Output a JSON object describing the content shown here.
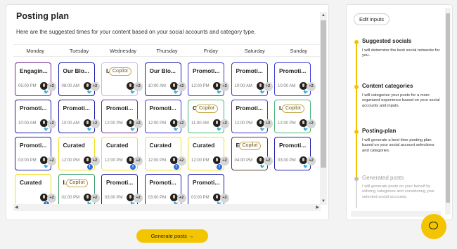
{
  "header": {
    "title": "Posting plan",
    "subtitle": "Here are the suggested times for your content based on your social accounts and category type."
  },
  "days": [
    "Monday",
    "Tuesday",
    "Wednesday",
    "Thursday",
    "Friday",
    "Saturday",
    "Sunday"
  ],
  "posts": [
    {
      "day": 0,
      "slot": 0,
      "title": "Engagin...",
      "time": "05:00 PM",
      "border": "#7a2a8f",
      "net": "tw"
    },
    {
      "day": 1,
      "slot": 0,
      "title": "Our Blo...",
      "time": "08:00 AM",
      "border": "#1d1da8",
      "net": "tw"
    },
    {
      "day": 2,
      "slot": 0,
      "title": "I...",
      "time": "",
      "border": "#c9b7e8",
      "net": "tw",
      "copilot": "Copilot"
    },
    {
      "day": 3,
      "slot": 0,
      "title": "Our Blo...",
      "time": "10:00 AM",
      "border": "#1d1da8",
      "net": "tw"
    },
    {
      "day": 4,
      "slot": 0,
      "title": "Promoti...",
      "time": "12:00 PM",
      "border": "#3a3ad8",
      "net": "tw"
    },
    {
      "day": 5,
      "slot": 0,
      "title": "Promoti...",
      "time": "10:00 AM",
      "border": "#3a3ad8",
      "net": "tw"
    },
    {
      "day": 6,
      "slot": 0,
      "title": "Promoti...",
      "time": "10:00 AM",
      "border": "#3a3ad8",
      "net": "tw"
    },
    {
      "day": 0,
      "slot": 1,
      "title": "Promoti...",
      "time": "10:00 AM",
      "border": "#1d1da8",
      "net": "tw"
    },
    {
      "day": 1,
      "slot": 1,
      "title": "Promoti...",
      "time": "10:00 AM",
      "border": "#1d1da8",
      "net": "tw"
    },
    {
      "day": 2,
      "slot": 1,
      "title": "Promoti...",
      "time": "12:00 PM",
      "border": "#7a2a8f",
      "net": "tw"
    },
    {
      "day": 3,
      "slot": 1,
      "title": "Promoti...",
      "time": "12:00 PM",
      "border": "#3a3ad8",
      "net": "tw"
    },
    {
      "day": 4,
      "slot": 1,
      "title": "C",
      "time": "11:00 AM",
      "border": "#4ab57a",
      "net": "tw",
      "copilot": "Copilot"
    },
    {
      "day": 5,
      "slot": 1,
      "title": "Promoti...",
      "time": "12:00 PM",
      "border": "#3a3ad8",
      "net": "tw"
    },
    {
      "day": 6,
      "slot": 1,
      "title": "I.",
      "time": "12:00 PM",
      "border": "#4ab57a",
      "net": "tw",
      "copilot": "Copilot"
    },
    {
      "day": 0,
      "slot": 2,
      "title": "Promoti...",
      "time": "03:00 PM",
      "border": "#1d1da8",
      "net": "tw"
    },
    {
      "day": 1,
      "slot": 2,
      "title": "Curated",
      "time": "12:00 PM",
      "border": "#f2e01a",
      "net": "fb"
    },
    {
      "day": 2,
      "slot": 2,
      "title": "Curated",
      "time": "12:00 PM",
      "border": "#f2e01a",
      "net": "fb"
    },
    {
      "day": 3,
      "slot": 2,
      "title": "Curated",
      "time": "12:00 PM",
      "border": "#f2e01a",
      "net": "fb"
    },
    {
      "day": 4,
      "slot": 2,
      "title": "Curated",
      "time": "12:00 PM",
      "border": "#f2e01a",
      "net": "fb"
    },
    {
      "day": 5,
      "slot": 2,
      "title": "E",
      "time": "04:00 PM",
      "border": "#5a3a2a",
      "net": "tw",
      "copilot": "Copilot"
    },
    {
      "day": 6,
      "slot": 2,
      "title": "Promoti...",
      "time": "03:00 PM",
      "border": "#1d1da8",
      "net": "tw"
    },
    {
      "day": 0,
      "slot": 3,
      "title": "Curated",
      "time": "",
      "border": "#f2e01a",
      "net": "fb"
    },
    {
      "day": 1,
      "slot": 3,
      "title": "I.",
      "time": "02:00 PM",
      "border": "#3a9a6a",
      "net": "tw",
      "copilot": "Copilot"
    },
    {
      "day": 2,
      "slot": 3,
      "title": "Promoti...",
      "time": "03:00 PM",
      "border": "#1d1da8",
      "net": "tw"
    },
    {
      "day": 3,
      "slot": 3,
      "title": "Promoti...",
      "time": "03:00 PM",
      "border": "#1d1da8",
      "net": "tw"
    },
    {
      "day": 4,
      "slot": 3,
      "title": "Promoti...",
      "time": "03:00 PM",
      "border": "#1d1da8",
      "net": "tw"
    }
  ],
  "avatar_extra": "+2",
  "sidebar": {
    "edit_label": "Edit inputs",
    "steps": [
      {
        "title": "Suggested socials",
        "desc": "I will determine the best social networks for you.",
        "state": "done"
      },
      {
        "title": "Content categories",
        "desc": "I will categorize your posts for a more organized experience based on your social accounts and inputs.",
        "state": "done"
      },
      {
        "title": "Posting-plan",
        "desc": "I will generate a best time posting plan based on your social account selections and categories.",
        "state": "done"
      },
      {
        "title": "Generated posts",
        "desc": "I will generate posts on your behalf by utilizing categories and considering your selected social accounts.",
        "state": "pending"
      }
    ]
  },
  "footer": {
    "generate_label": "Generate posts →"
  },
  "colors": {
    "accent": "#f3c500",
    "step_active": "#f2c200",
    "step_pending": "#bdbdbd"
  },
  "icons": {
    "chat": "chat-icon",
    "twitter": "twitter-icon",
    "facebook": "facebook-icon"
  }
}
